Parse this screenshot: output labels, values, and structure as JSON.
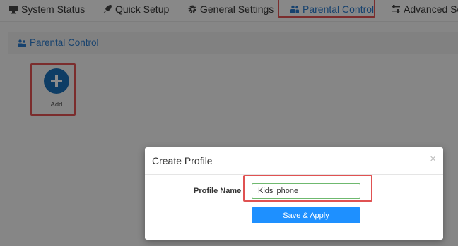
{
  "topnav": {
    "items": [
      {
        "label": "System Status",
        "icon": "monitor-icon"
      },
      {
        "label": "Quick Setup",
        "icon": "rocket-icon"
      },
      {
        "label": "General Settings",
        "icon": "gear-icon"
      },
      {
        "label": "Parental Control",
        "icon": "users-icon",
        "active": true
      },
      {
        "label": "Advanced Set",
        "icon": "sliders-icon"
      }
    ],
    "active_color": "#2b78c8"
  },
  "section": {
    "title": "Parental Control",
    "icon": "users-icon"
  },
  "add": {
    "label": "Add",
    "icon": "plus-circle-icon",
    "color": "#1a6fb8"
  },
  "modal": {
    "title": "Create Profile",
    "close_glyph": "×",
    "field_label": "Profile Name",
    "field_value": "Kids' phone",
    "submit_label": "Save & Apply",
    "submit_color": "#1e90ff"
  },
  "highlight_color": "#e05252"
}
